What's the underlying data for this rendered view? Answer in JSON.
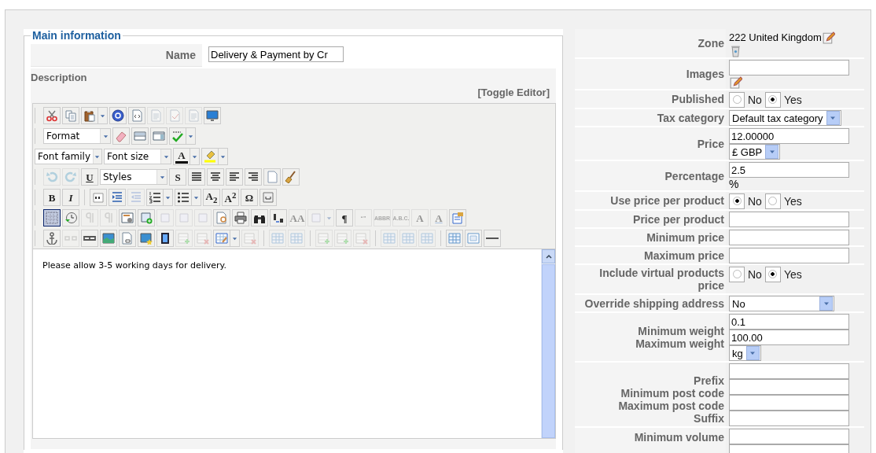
{
  "main_information": {
    "legend": "Main information",
    "name_label": "Name",
    "name_value": "Delivery & Payment by Cr",
    "description_label": "Description",
    "toggle_editor": "[Toggle Editor]",
    "editor": {
      "toolbar": [
        [
          {
            "kind": "button",
            "disabled": false,
            "active": false
          },
          {
            "kind": "button",
            "disabled": false,
            "active": false
          },
          {
            "kind": "split",
            "disabled": false,
            "active": false
          },
          {
            "kind": "button",
            "disabled": false,
            "active": false
          },
          {
            "kind": "button",
            "disabled": false,
            "active": false
          },
          {
            "kind": "button",
            "disabled": true,
            "active": false
          },
          {
            "kind": "button",
            "disabled": true,
            "active": false
          },
          {
            "kind": "button",
            "disabled": true,
            "active": false
          },
          {
            "kind": "button",
            "disabled": false,
            "active": false
          }
        ],
        [
          {
            "kind": "select",
            "value": "Format"
          },
          {
            "kind": "button",
            "disabled": false,
            "active": false
          },
          {
            "kind": "button",
            "disabled": false,
            "active": false
          },
          {
            "kind": "button",
            "disabled": false,
            "active": false
          },
          {
            "kind": "split",
            "disabled": false,
            "active": false
          }
        ],
        [
          {
            "kind": "select",
            "value": "Font family"
          },
          {
            "kind": "select",
            "value": "Font size"
          },
          {
            "kind": "split",
            "label": "A",
            "disabled": false,
            "active": false
          },
          {
            "kind": "split",
            "disabled": false,
            "active": false
          }
        ],
        [
          {
            "kind": "button",
            "disabled": true,
            "active": false
          },
          {
            "kind": "button",
            "disabled": true,
            "active": false
          },
          {
            "kind": "button",
            "label": "U",
            "disabled": false,
            "active": false
          },
          {
            "kind": "select",
            "value": "Styles"
          },
          {
            "kind": "button",
            "label": "S",
            "disabled": false,
            "active": false
          },
          {
            "kind": "button",
            "disabled": false,
            "active": false
          },
          {
            "kind": "button",
            "disabled": false,
            "active": false
          },
          {
            "kind": "button",
            "disabled": false,
            "active": false
          },
          {
            "kind": "button",
            "disabled": false,
            "active": false
          },
          {
            "kind": "button",
            "disabled": false,
            "active": false
          },
          {
            "kind": "button",
            "disabled": false,
            "active": false
          }
        ],
        [
          {
            "kind": "button",
            "label": "B",
            "disabled": false,
            "active": false
          },
          {
            "kind": "button",
            "label": "I",
            "disabled": false,
            "active": false
          },
          {
            "kind": "separator"
          },
          {
            "kind": "button",
            "disabled": false,
            "active": false
          },
          {
            "kind": "button",
            "disabled": false,
            "active": false
          },
          {
            "kind": "button",
            "disabled": true,
            "active": false
          },
          {
            "kind": "split",
            "disabled": false,
            "active": false
          },
          {
            "kind": "split",
            "disabled": false,
            "active": false
          },
          {
            "kind": "button",
            "label": "A$_{2}$",
            "disabled": false,
            "active": false
          },
          {
            "kind": "button",
            "label": "A$^{2}$",
            "disabled": false,
            "active": false
          },
          {
            "kind": "button",
            "label": "Ω",
            "disabled": false,
            "active": false
          },
          {
            "kind": "button",
            "disabled": false,
            "active": false
          }
        ],
        [
          {
            "kind": "button",
            "disabled": false,
            "active": true
          },
          {
            "kind": "button",
            "disabled": false,
            "active": false
          },
          {
            "kind": "button",
            "disabled": true,
            "active": false
          },
          {
            "kind": "button",
            "disabled": true,
            "active": false
          },
          {
            "kind": "button",
            "disabled": false,
            "active": false
          },
          {
            "kind": "button",
            "disabled": false,
            "active": false
          },
          {
            "kind": "button",
            "disabled": true,
            "active": false
          },
          {
            "kind": "button",
            "disabled": true,
            "active": false
          },
          {
            "kind": "button",
            "disabled": true,
            "active": false
          },
          {
            "kind": "button",
            "disabled": false,
            "active": false
          },
          {
            "kind": "button",
            "disabled": false,
            "active": false
          },
          {
            "kind": "button",
            "disabled": false,
            "active": false
          },
          {
            "kind": "button",
            "disabled": false,
            "active": false
          },
          {
            "kind": "button",
            "label": "AA",
            "disabled": true,
            "active": false
          },
          {
            "kind": "split",
            "disabled": true,
            "active": false
          },
          {
            "kind": "button",
            "label": "¶",
            "disabled": false,
            "active": false
          },
          {
            "kind": "button",
            "label": "“”",
            "disabled": true,
            "active": false
          },
          {
            "kind": "button",
            "label": "ABBR",
            "disabled": true,
            "active": false
          },
          {
            "kind": "button",
            "label": "A.B.C.",
            "disabled": true,
            "active": false
          },
          {
            "kind": "button",
            "label": "A",
            "disabled": true,
            "active": false
          },
          {
            "kind": "button",
            "label": "A",
            "disabled": true,
            "active": false
          },
          {
            "kind": "button",
            "disabled": false,
            "active": false
          }
        ],
        [
          {
            "kind": "button",
            "disabled": false,
            "active": false
          },
          {
            "kind": "button",
            "disabled": true,
            "active": false
          },
          {
            "kind": "button",
            "disabled": false,
            "active": false
          },
          {
            "kind": "button",
            "disabled": false,
            "active": false
          },
          {
            "kind": "button",
            "disabled": false,
            "active": false
          },
          {
            "kind": "button",
            "disabled": false,
            "active": false
          },
          {
            "kind": "button",
            "disabled": false,
            "active": false
          },
          {
            "kind": "button",
            "disabled": true,
            "active": false
          },
          {
            "kind": "button",
            "disabled": true,
            "active": false
          },
          {
            "kind": "split",
            "disabled": false,
            "active": false
          },
          {
            "kind": "button",
            "disabled": true,
            "active": false
          },
          {
            "kind": "separator"
          },
          {
            "kind": "button",
            "disabled": true,
            "active": false
          },
          {
            "kind": "button",
            "disabled": true,
            "active": false
          },
          {
            "kind": "separator"
          },
          {
            "kind": "button",
            "disabled": true,
            "active": false
          },
          {
            "kind": "button",
            "disabled": true,
            "active": false
          },
          {
            "kind": "button",
            "disabled": true,
            "active": false
          },
          {
            "kind": "separator"
          },
          {
            "kind": "button",
            "disabled": true,
            "active": false
          },
          {
            "kind": "button",
            "disabled": true,
            "active": false
          },
          {
            "kind": "button",
            "disabled": true,
            "active": false
          },
          {
            "kind": "separator"
          },
          {
            "kind": "button",
            "disabled": false,
            "active": false
          },
          {
            "kind": "button",
            "disabled": false,
            "active": false
          },
          {
            "kind": "button",
            "disabled": false,
            "active": false
          }
        ]
      ],
      "content": "Please allow 3-5 working days for delivery."
    }
  },
  "properties": [
    {
      "kind": "zone",
      "labels": [
        "Zone"
      ],
      "value": "222 United Kingdom"
    },
    {
      "kind": "image",
      "labels": [
        "Images"
      ],
      "inputs": [
        {
          "kind": "text"
        }
      ]
    },
    {
      "kind": "radio",
      "labels": [
        "Published"
      ],
      "options": [
        {
          "label": "No",
          "selected": false
        },
        {
          "label": "Yes",
          "selected": true
        }
      ]
    },
    {
      "kind": "select",
      "labels": [
        "Tax category"
      ],
      "value": "Default tax category"
    },
    {
      "kind": "input_select",
      "labels": [
        "Price"
      ],
      "inputs": [
        {
          "kind": "text",
          "value": "12.00000"
        }
      ],
      "unit": "£ GBP"
    },
    {
      "kind": "input_suffix",
      "labels": [
        "Percentage"
      ],
      "inputs": [
        {
          "kind": "text",
          "value": "2.5"
        }
      ],
      "suffix": "%"
    },
    {
      "kind": "radio",
      "labels": [
        "Use price per product"
      ],
      "options": [
        {
          "label": "No",
          "selected": true
        },
        {
          "label": "Yes",
          "selected": false
        }
      ]
    },
    {
      "kind": "input",
      "labels": [
        "Price per product"
      ],
      "inputs": [
        {
          "kind": "text"
        }
      ]
    },
    {
      "kind": "input",
      "labels": [
        "Minimum price"
      ],
      "inputs": [
        {
          "kind": "text"
        }
      ]
    },
    {
      "kind": "input",
      "labels": [
        "Maximum price"
      ],
      "inputs": [
        {
          "kind": "text"
        }
      ]
    },
    {
      "kind": "radio",
      "labels": [
        "Include virtual products price"
      ],
      "options": [
        {
          "label": "No",
          "selected": false
        },
        {
          "label": "Yes",
          "selected": true
        }
      ]
    },
    {
      "kind": "wide_select",
      "labels": [
        "Override shipping address"
      ],
      "value": "No"
    },
    {
      "kind": "input_select",
      "labels": [
        "Minimum weight",
        "Maximum weight"
      ],
      "inputs": [
        {
          "kind": "text",
          "value": "0.1"
        },
        {
          "kind": "text",
          "value": "100.00"
        }
      ],
      "unit": "kg"
    },
    {
      "kind": "input",
      "labels": [
        "Prefix",
        "Minimum post code",
        "Maximum post code",
        "Suffix"
      ],
      "inputs": [
        {
          "kind": "text"
        },
        {
          "kind": "text"
        },
        {
          "kind": "text"
        },
        {
          "kind": "text"
        }
      ]
    },
    {
      "kind": "input",
      "labels": [
        "Minimum volume"
      ],
      "inputs": [
        {
          "kind": "text"
        },
        {
          "kind": "text"
        }
      ]
    }
  ]
}
